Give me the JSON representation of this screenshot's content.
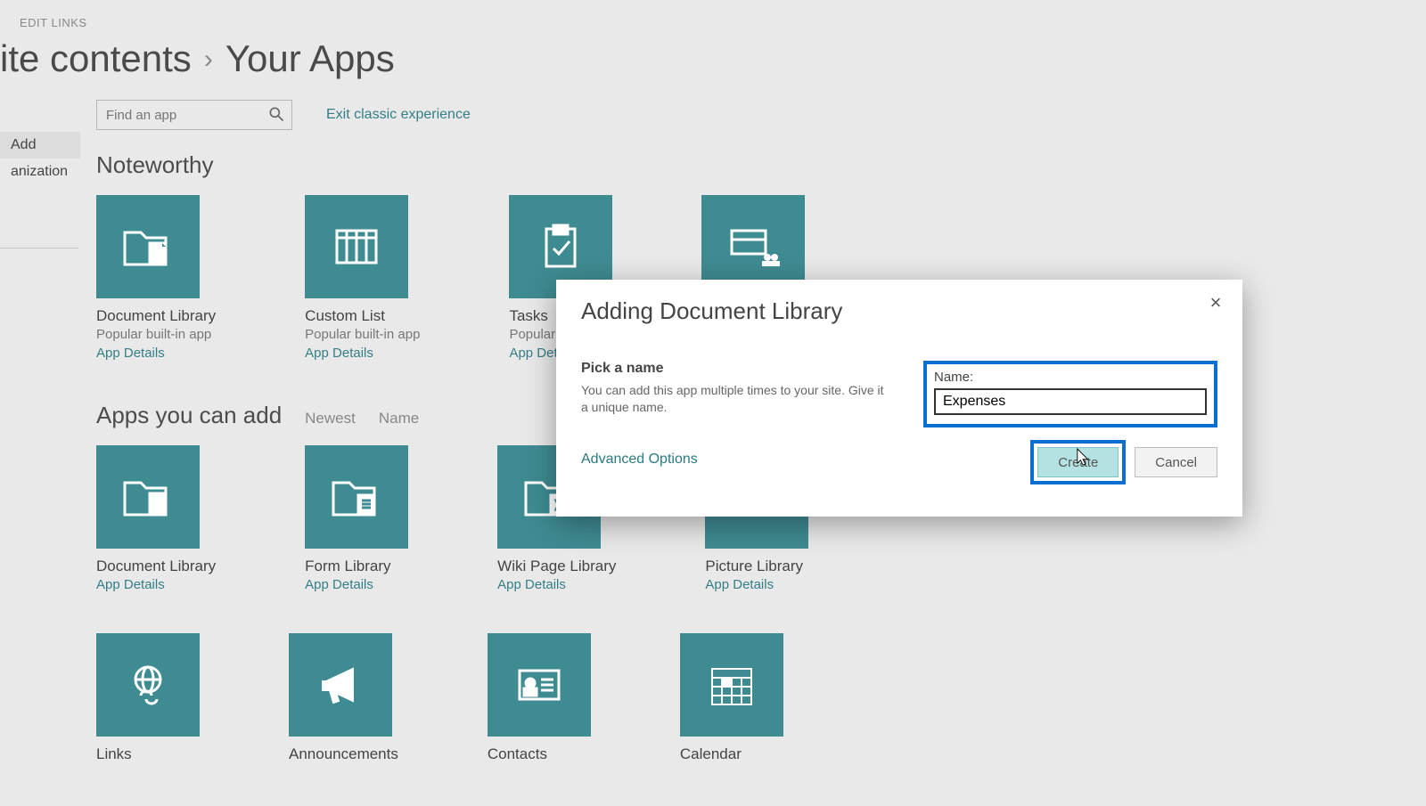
{
  "header": {
    "edit_links": "EDIT LINKS",
    "bc_parent": "ite contents",
    "bc_sep": "›",
    "bc_current": "Your Apps"
  },
  "search": {
    "placeholder": "Find an app"
  },
  "exit_link": "Exit classic experience",
  "leftnav": {
    "item_add": "Add",
    "item_org": "anization"
  },
  "sections": {
    "noteworthy": "Noteworthy",
    "apps_you_can": "Apps you can add",
    "sort_newest": "Newest",
    "sort_name": "Name"
  },
  "tiles": {
    "doclib": "Document Library",
    "customlist": "Custom List",
    "tasks": "Tasks",
    "popular": "Popular built-in app",
    "popular_trunc": "Popular bu",
    "details": "App Details",
    "formlib": "Form Library",
    "wiki": "Wiki Page Library",
    "picture": "Picture Library",
    "links": "Links",
    "announcements": "Announcements",
    "contacts": "Contacts",
    "calendar": "Calendar"
  },
  "dialog": {
    "title": "Adding Document Library",
    "pick": "Pick a name",
    "desc": "You can add this app multiple times to your site. Give it a unique name.",
    "advanced": "Advanced Options",
    "name_label": "Name:",
    "name_value": "Expenses",
    "create": "Create",
    "cancel": "Cancel"
  }
}
